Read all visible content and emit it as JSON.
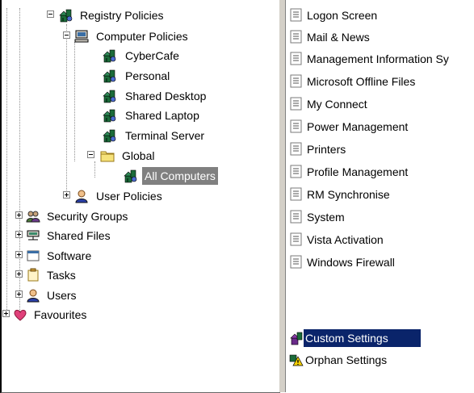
{
  "tree": {
    "registry_policies": "Registry Policies",
    "computer_policies": "Computer Policies",
    "cybercafe": "CyberCafe",
    "personal": "Personal",
    "shared_desktop": "Shared Desktop",
    "shared_laptop": "Shared Laptop",
    "terminal_server": "Terminal Server",
    "global": "Global",
    "all_computers": "All Computers",
    "user_policies": "User Policies",
    "security_groups": "Security Groups",
    "shared_files": "Shared Files",
    "software": "Software",
    "tasks": "Tasks",
    "users": "Users",
    "favourites": "Favourites"
  },
  "list": {
    "items": [
      "Logon Screen",
      "Mail & News",
      "Management Information Sy",
      "Microsoft Offline Files",
      "My Connect",
      "Power Management",
      "Printers",
      "Profile Management",
      "RM Synchronise",
      "System",
      "Vista Activation",
      "Windows Firewall"
    ],
    "custom_settings": "Custom Settings",
    "orphan_settings": "Orphan Settings"
  },
  "colors": {
    "selection_gray": "#808080",
    "selection_blue": "#0a246a",
    "favourites_heart": "#e0407a"
  }
}
